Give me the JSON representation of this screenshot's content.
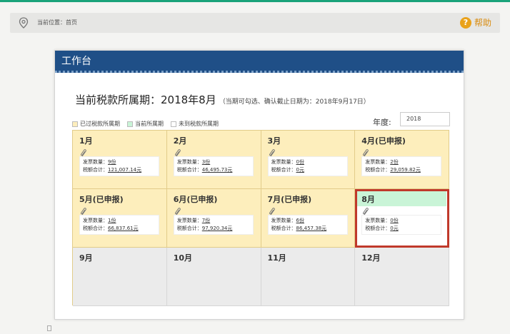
{
  "location": {
    "text": "当前位置：首页"
  },
  "help": {
    "label": "帮助"
  },
  "panel": {
    "title": "工作台"
  },
  "period": {
    "main": "当前税款所属期：2018年8月",
    "note": "（当期可勾选、确认截止日期为：2018年9月17日）"
  },
  "legend": [
    {
      "label": "已过税款所属期",
      "color": "#fdeebc"
    },
    {
      "label": "当前所属期",
      "color": "#c9f4d7"
    },
    {
      "label": "未到税款所属期",
      "color": "#ffffff"
    }
  ],
  "year": {
    "label": "年度:",
    "value": "2018"
  },
  "labels": {
    "invoice": "发票数量：",
    "tax": "税额合计："
  },
  "months": [
    {
      "name": "1月",
      "status": "past",
      "invoice": "9份",
      "tax": "121,007.14元"
    },
    {
      "name": "2月",
      "status": "past",
      "invoice": "3份",
      "tax": "46,495.73元"
    },
    {
      "name": "3月",
      "status": "past",
      "invoice": "0份",
      "tax": "0元"
    },
    {
      "name": "4月(已申报)",
      "status": "past",
      "invoice": "2份",
      "tax": "29,059.82元"
    },
    {
      "name": "5月(已申报)",
      "status": "past",
      "invoice": "1份",
      "tax": "66,837.61元"
    },
    {
      "name": "6月(已申报)",
      "status": "past",
      "invoice": "7份",
      "tax": "97,920.34元"
    },
    {
      "name": "7月(已申报)",
      "status": "past",
      "invoice": "6份",
      "tax": "86,457.38元"
    },
    {
      "name": "8月",
      "status": "current",
      "invoice": "0份",
      "tax": "0元"
    },
    {
      "name": "9月",
      "status": "future"
    },
    {
      "name": "10月",
      "status": "future"
    },
    {
      "name": "11月",
      "status": "future"
    },
    {
      "name": "12月",
      "status": "future"
    }
  ],
  "colors": {
    "header": "#1f4f87",
    "past": "#fdeebc",
    "current_highlight": "#c0392b",
    "future": "#ebebeb",
    "accent_green": "#1aa37a"
  }
}
